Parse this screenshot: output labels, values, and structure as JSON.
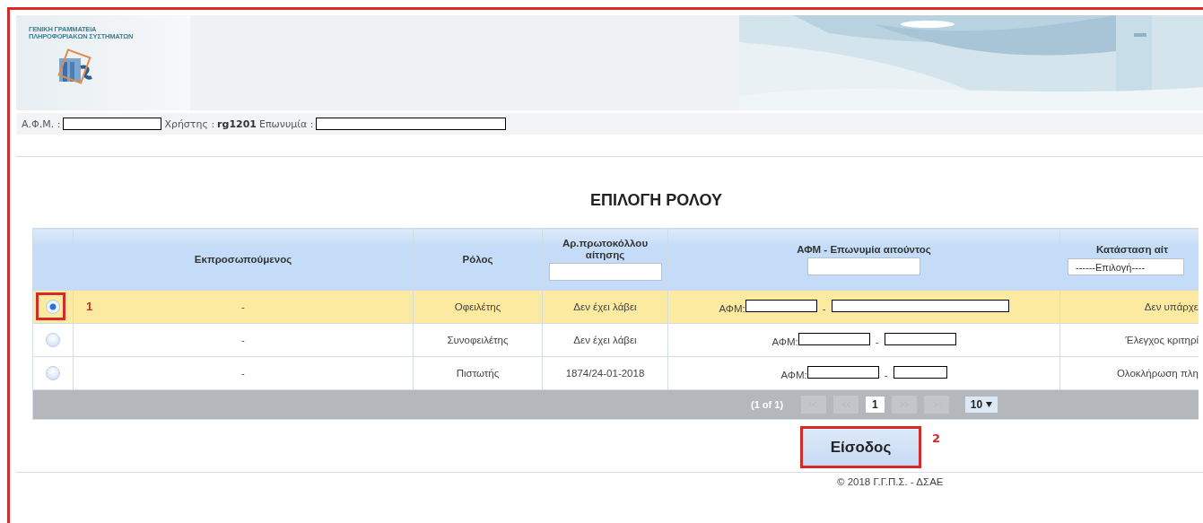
{
  "header": {
    "org_lines": [
      "ΓΕΝΙΚΗ ΓΡΑΜΜΑΤΕΙΑ",
      "ΠΛΗΡΟΦΟΡΙΑΚΩΝ ΣΥΣΤΗΜΑΤΩΝ"
    ],
    "banner": {
      "kind": "picture"
    }
  },
  "user_bar": {
    "tax_id_label": "Α.Φ.Μ. :",
    "user_label": "Χρήστης :",
    "user": "rg1201",
    "name_label": "Επωνυμία :"
  },
  "title": "ΕΠΙΛΟΓΗ ΡΟΛΟΥ",
  "table": {
    "columns": [
      {
        "label": "Εκπροσωπούμενος"
      },
      {
        "label": "Ρόλος"
      },
      {
        "label": "Αρ.πρωτοκόλλου αίτησης",
        "filter": {
          "kind": "text"
        }
      },
      {
        "label": "ΑΦΜ - Επωνυμία αιτούντος",
        "filter": {
          "kind": "text"
        }
      },
      {
        "label": "Κατάσταση αίτ",
        "filter": {
          "kind": "select",
          "placeholder": "------Επιλογή----"
        }
      }
    ],
    "rows": [
      {
        "selected": true,
        "represented": "-",
        "role": "Οφειλέτης",
        "protocol": "Δεν έχει λάβει",
        "tax_prefix": "ΑΦΜ:",
        "separator": "-",
        "status": "Δεν υπάρχε",
        "annotation": "1"
      },
      {
        "selected": false,
        "represented": "-",
        "role": "Συνοφειλέτης",
        "protocol": "Δεν έχει λάβει",
        "tax_prefix": "ΑΦΜ:",
        "separator": "-",
        "status": "Έλεγχος κριτηρί"
      },
      {
        "selected": false,
        "represented": "-",
        "role": "Πιστωτής",
        "protocol": "1874/24-01-2018",
        "tax_prefix": "ΑΦΜ:",
        "separator": "-",
        "status": "Ολοκλήρωση πλη"
      }
    ],
    "paginator": {
      "summary": "(1 of 1)",
      "pages": [
        {
          "label": "1",
          "selected": true
        }
      ],
      "rows_per_page": "10"
    }
  },
  "submit": {
    "label": "Είσοδος",
    "annotation": "2"
  },
  "footer": "© 2018 Γ.Γ.Π.Σ. - ΔΣΑΕ"
}
